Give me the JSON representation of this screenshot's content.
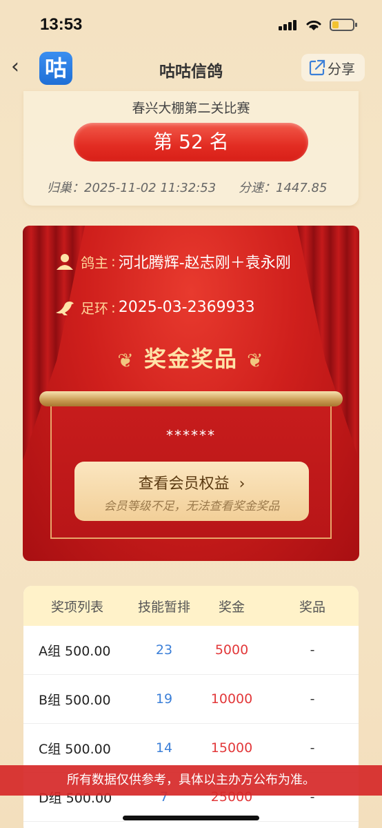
{
  "status_bar": {
    "time": "13:53"
  },
  "nav": {
    "title": "咕咕信鸽",
    "logo_text": "咕",
    "share_label": "分享"
  },
  "rank_card": {
    "match_name": "春兴大棚第二关比赛",
    "rank": "第 52 名",
    "arrival_label": "归巢：",
    "arrival_time": "2025-11-02 11:32:53",
    "speed_label": "分速：",
    "speed": "1447.85"
  },
  "prize_card": {
    "owner_label": "鸽主",
    "owner_value": "河北腾辉-赵志刚＋袁永刚",
    "ring_label": "足环",
    "ring_value": "2025-03-2369933",
    "title": "奖金奖品",
    "hidden_value": "******",
    "vip_button_label": "查看会员权益",
    "vip_button_sub": "会员等级不足，无法查看奖金奖品"
  },
  "prize_table": {
    "headers": [
      "奖项列表",
      "技能暂排",
      "奖金",
      "奖品"
    ],
    "rows": [
      [
        "A组 500.00",
        "23",
        "5000",
        "-"
      ],
      [
        "B组 500.00",
        "19",
        "10000",
        "-"
      ],
      [
        "C组 500.00",
        "14",
        "15000",
        "-"
      ],
      [
        "D组 500.00",
        "7",
        "25000",
        "-"
      ]
    ]
  },
  "disclaimer": "所有数据仅供参考，具体以主办方公布为准。",
  "colors": {
    "accent_red": "#e22c22",
    "gold": "#ffe3a8",
    "rank_blue": "#3b7fd8",
    "prize_red": "#e2383a"
  }
}
